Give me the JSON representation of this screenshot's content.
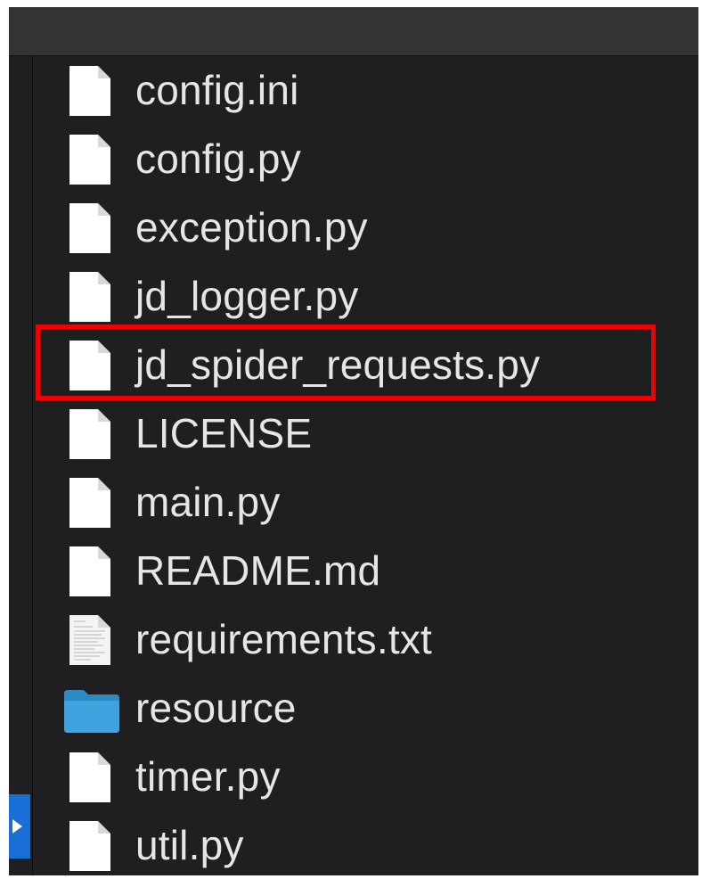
{
  "files": [
    {
      "name": "config.ini",
      "icon": "document-icon"
    },
    {
      "name": "config.py",
      "icon": "document-icon"
    },
    {
      "name": "exception.py",
      "icon": "document-icon"
    },
    {
      "name": "jd_logger.py",
      "icon": "document-icon"
    },
    {
      "name": "jd_spider_requests.py",
      "icon": "document-icon",
      "highlighted": true
    },
    {
      "name": "LICENSE",
      "icon": "document-icon"
    },
    {
      "name": "main.py",
      "icon": "document-icon"
    },
    {
      "name": "README.md",
      "icon": "document-icon"
    },
    {
      "name": "requirements.txt",
      "icon": "text-document-icon"
    },
    {
      "name": "resource",
      "icon": "folder-icon"
    },
    {
      "name": "timer.py",
      "icon": "document-icon"
    },
    {
      "name": "util.py",
      "icon": "document-icon"
    }
  ],
  "colors": {
    "window_bg": "#1f1f22",
    "toolbar_bg": "#333336",
    "text": "#e6e6e6",
    "highlight_border": "#f00000",
    "selection_accent": "#1a6fd6",
    "folder": "#3fa3e0"
  }
}
